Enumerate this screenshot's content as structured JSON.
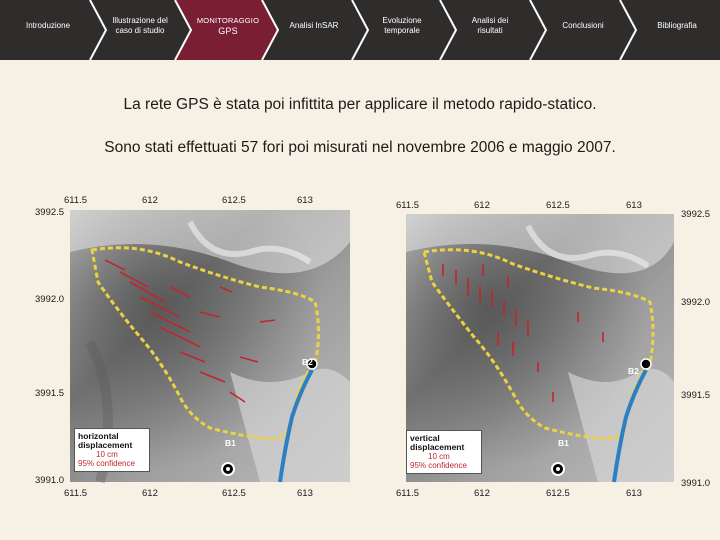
{
  "nav": {
    "items": [
      {
        "label": "Introduzione",
        "active": false
      },
      {
        "label": "Illustrazione del caso di studio",
        "active": false
      },
      {
        "label": "Monitoraggio GPS",
        "active": true
      },
      {
        "label": "Analisi InSAR",
        "active": false
      },
      {
        "label": "Evoluzione temporale",
        "active": false
      },
      {
        "label": "Analisi dei risultati",
        "active": false
      },
      {
        "label": "Conclusioni",
        "active": false
      },
      {
        "label": "Bibliografia",
        "active": false
      }
    ],
    "active_line1": "MONITORAGGIO",
    "active_line2": "GPS",
    "colors": {
      "bar": "#2f2c2c",
      "active": "#7a1f33",
      "divider": "#ffffff"
    }
  },
  "content": {
    "line1": "La rete GPS è stata poi infittita per applicare il metodo rapido-statico.",
    "line2": "Sono stati effettuati 57 fori poi misurati nel novembre 2006 e maggio 2007."
  },
  "maps": {
    "left": {
      "top_ticks": [
        "611.5",
        "612",
        "612.5",
        "613"
      ],
      "bottom_ticks": [
        "611.5",
        "612",
        "612.5",
        "613"
      ],
      "left_ticks": [
        "3992.5",
        "3992.0",
        "3991.5",
        "3991.0"
      ],
      "legend_title_1": "horizontal",
      "legend_title_2": "displacement",
      "legend_scale": "10 cm",
      "legend_conf": "95% confidence",
      "station_b1": "B1",
      "station_b2": "B2"
    },
    "right": {
      "top_ticks": [
        "611.5",
        "612",
        "612.5",
        "613"
      ],
      "bottom_ticks": [
        "611.5",
        "612",
        "612.5",
        "613"
      ],
      "right_ticks": [
        "3992.5",
        "3992.0",
        "3991.5",
        "3991.0"
      ],
      "legend_title_1": "vertical",
      "legend_title_2": "displacement",
      "legend_scale": "10 cm",
      "legend_conf": "95% confidence",
      "station_b1": "B1",
      "station_b2": "B2"
    }
  }
}
